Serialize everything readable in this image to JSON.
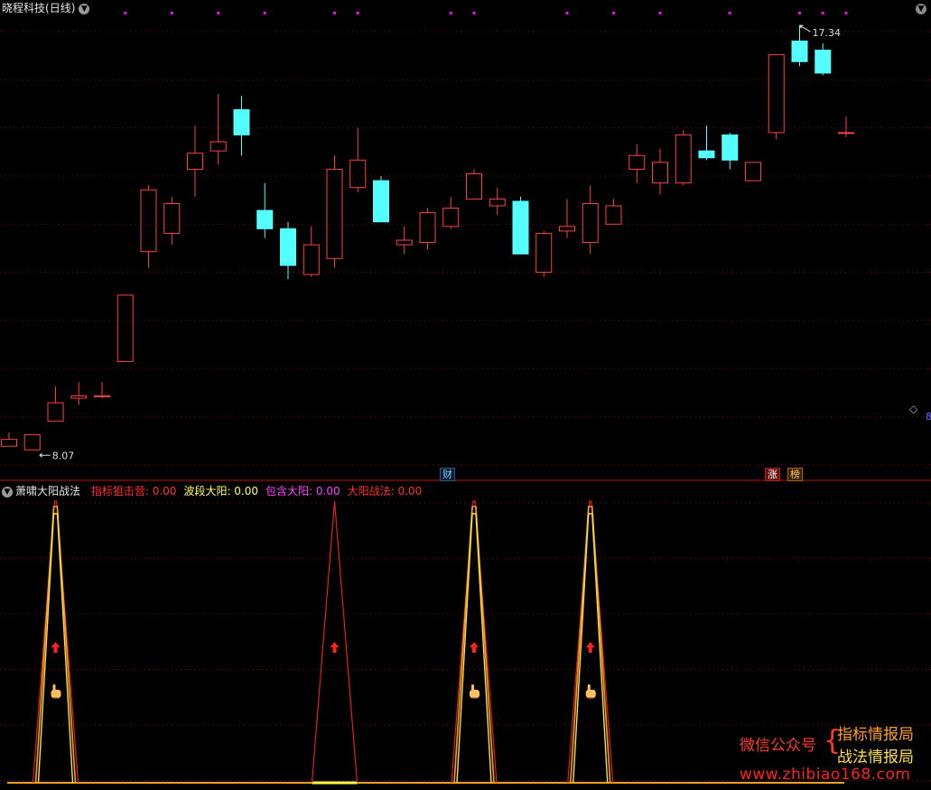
{
  "window": {
    "title": "晓程科技",
    "period": "(日线)"
  },
  "price_panel": {
    "high_label": "17.34",
    "low_label": "8.07",
    "right_marker": "8",
    "event_badges": [
      "财",
      "涨",
      "榜"
    ],
    "colors": {
      "up": "#ff4040",
      "down": "#54ffff",
      "grid": "#8b0000",
      "dots": "#ff00ff"
    }
  },
  "indicator_panel": {
    "name": "萧啸大阳战法",
    "items": [
      {
        "label": "指标狙击营:",
        "value": "0.00",
        "color": "#ff3030"
      },
      {
        "label": "波段大阳:",
        "value": "0.00",
        "color": "#ffff66"
      },
      {
        "label": "包含大阳:",
        "value": "0.00",
        "color": "#ff40ff"
      },
      {
        "label": "大阳战法:",
        "value": "0.00",
        "color": "#ff3030"
      }
    ]
  },
  "watermark": {
    "wechat": "微信公众号",
    "name1": "指标情报局",
    "name2": "战法情报局",
    "url": "www.zhibiao168.com"
  },
  "chart_data": {
    "type": "candlestick",
    "candles": [
      {
        "o": 8.15,
        "c": 8.3,
        "h": 8.45,
        "l": 8.15
      },
      {
        "o": 8.07,
        "c": 8.4,
        "h": 8.4,
        "l": 8.07
      },
      {
        "o": 8.7,
        "c": 9.1,
        "h": 9.45,
        "l": 8.7
      },
      {
        "o": 9.2,
        "c": 9.25,
        "h": 9.55,
        "l": 9.05
      },
      {
        "o": 9.25,
        "c": 9.25,
        "h": 9.55,
        "l": 9.2
      },
      {
        "o": 10.0,
        "c": 11.45,
        "h": 11.45,
        "l": 10.0
      },
      {
        "o": 12.4,
        "c": 13.75,
        "h": 13.85,
        "l": 12.05
      },
      {
        "o": 12.8,
        "c": 13.45,
        "h": 13.6,
        "l": 12.55
      },
      {
        "o": 14.2,
        "c": 14.55,
        "h": 15.15,
        "l": 13.6
      },
      {
        "o": 14.6,
        "c": 14.8,
        "h": 15.85,
        "l": 14.3
      },
      {
        "o": 15.5,
        "c": 14.95,
        "h": 15.8,
        "l": 14.5
      },
      {
        "o": 13.3,
        "c": 12.9,
        "h": 13.9,
        "l": 12.7
      },
      {
        "o": 12.9,
        "c": 12.1,
        "h": 13.05,
        "l": 11.8
      },
      {
        "o": 11.9,
        "c": 12.55,
        "h": 12.95,
        "l": 11.85
      },
      {
        "o": 12.25,
        "c": 14.2,
        "h": 14.5,
        "l": 12.05
      },
      {
        "o": 13.8,
        "c": 14.4,
        "h": 15.1,
        "l": 13.7
      },
      {
        "o": 13.95,
        "c": 13.05,
        "h": 14.05,
        "l": 13.05
      },
      {
        "o": 12.55,
        "c": 12.65,
        "h": 12.95,
        "l": 12.35
      },
      {
        "o": 12.6,
        "c": 13.25,
        "h": 13.35,
        "l": 12.45
      },
      {
        "o": 12.95,
        "c": 13.35,
        "h": 13.6,
        "l": 12.9
      },
      {
        "o": 13.55,
        "c": 14.1,
        "h": 14.2,
        "l": 13.55
      },
      {
        "o": 13.4,
        "c": 13.55,
        "h": 13.8,
        "l": 13.2
      },
      {
        "o": 13.5,
        "c": 12.35,
        "h": 13.6,
        "l": 12.35
      },
      {
        "o": 11.95,
        "c": 12.8,
        "h": 12.85,
        "l": 11.85
      },
      {
        "o": 12.85,
        "c": 12.95,
        "h": 13.55,
        "l": 12.7
      },
      {
        "o": 12.6,
        "c": 13.45,
        "h": 13.85,
        "l": 12.35
      },
      {
        "o": 13.0,
        "c": 13.4,
        "h": 13.55,
        "l": 13.0
      },
      {
        "o": 14.2,
        "c": 14.5,
        "h": 14.75,
        "l": 13.9
      },
      {
        "o": 13.9,
        "c": 14.35,
        "h": 14.65,
        "l": 13.65
      },
      {
        "o": 13.9,
        "c": 14.95,
        "h": 15.05,
        "l": 13.85
      },
      {
        "o": 14.6,
        "c": 14.45,
        "h": 15.15,
        "l": 14.4
      },
      {
        "o": 14.95,
        "c": 14.4,
        "h": 15.0,
        "l": 14.2
      },
      {
        "o": 13.95,
        "c": 14.35,
        "h": 14.35,
        "l": 13.95
      },
      {
        "o": 15.0,
        "c": 16.7,
        "h": 16.7,
        "l": 14.85
      },
      {
        "o": 17.0,
        "c": 16.55,
        "h": 17.34,
        "l": 16.45
      },
      {
        "o": 16.8,
        "c": 16.3,
        "h": 16.95,
        "l": 16.25
      },
      {
        "o": 15.0,
        "c": 15.0,
        "h": 15.35,
        "l": 14.9
      }
    ],
    "price_range": [
      7.8,
      17.6
    ],
    "signals": {
      "spike_indices": [
        2,
        14,
        20,
        25
      ],
      "single_red_index": 14,
      "arrow_indices": [
        2,
        14,
        20,
        25
      ],
      "hand_indices": [
        2,
        20,
        25
      ],
      "top_marker_indices": [
        5,
        7,
        9,
        11,
        14,
        15,
        19,
        20,
        24,
        26,
        28,
        31,
        34,
        35,
        36
      ]
    }
  }
}
